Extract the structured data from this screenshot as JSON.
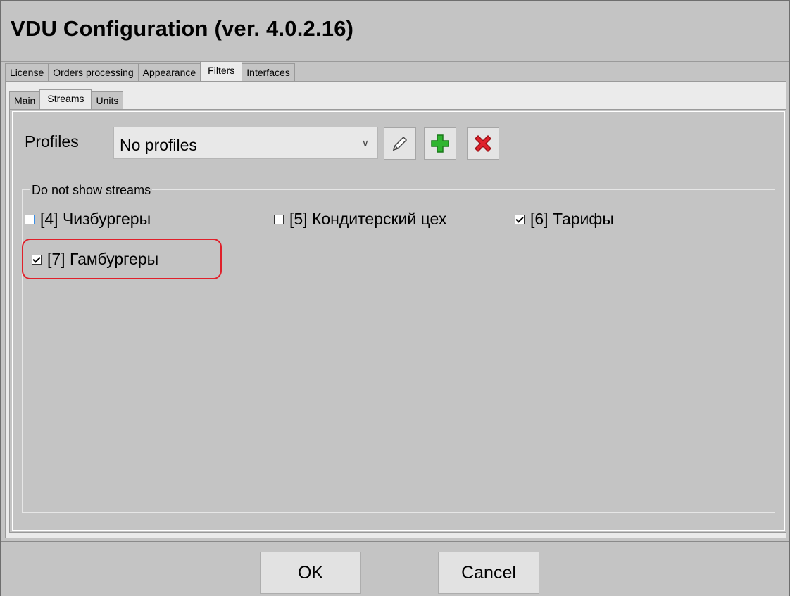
{
  "window": {
    "title": "VDU Configuration (ver. 4.0.2.16)"
  },
  "tabs": [
    "License",
    "Orders processing",
    "Appearance",
    "Filters",
    "Interfaces"
  ],
  "subtabs": [
    "Main",
    "Streams",
    "Units"
  ],
  "profiles": {
    "label": "Profiles",
    "selected": "No profiles",
    "edit_icon": "pencil-icon",
    "add_icon": "plus-icon",
    "delete_icon": "delete-x-icon",
    "add_color": "#2fb52f",
    "delete_color": "#e0202a"
  },
  "streams_group": {
    "legend": "Do not show streams",
    "items": [
      {
        "label": "[4] Чизбургеры",
        "checked": false
      },
      {
        "label": "[5] Кондитерский цех",
        "checked": false
      },
      {
        "label": "[6] Тарифы",
        "checked": true
      },
      {
        "label": "[7] Гамбургеры",
        "checked": true
      }
    ],
    "highlight_color": "#e0202a"
  },
  "footer": {
    "ok_label": "OK",
    "cancel_label": "Cancel"
  }
}
